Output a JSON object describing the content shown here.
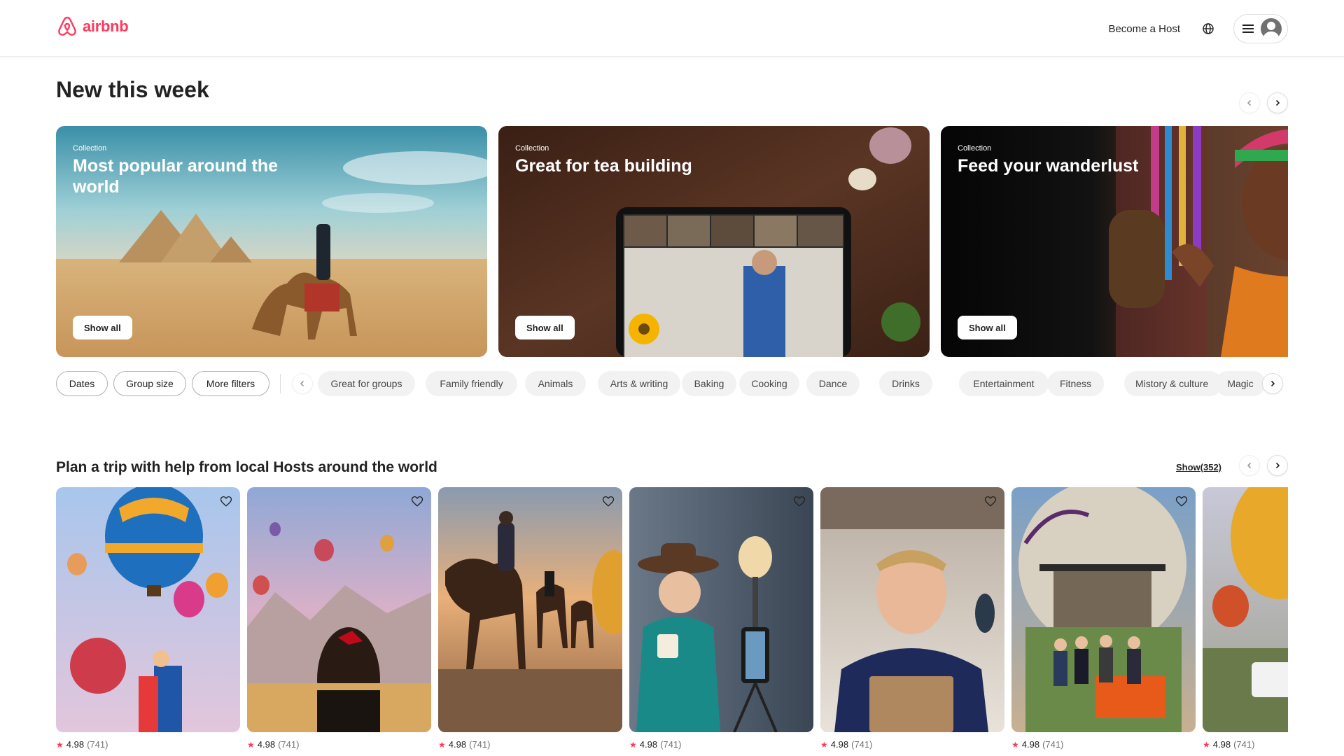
{
  "header": {
    "logo_text": "airbnb",
    "become_host": "Become a Host",
    "brand_color": "#ff385c"
  },
  "section1": {
    "title": "New this week",
    "collections": [
      {
        "label": "Collection",
        "title": "Most popular around the world",
        "button": "Show all"
      },
      {
        "label": "Collection",
        "title": "Great for tea building",
        "button": "Show all"
      },
      {
        "label": "Collection",
        "title": "Feed your wanderlust",
        "button": "Show all"
      }
    ]
  },
  "filters": {
    "outlined": [
      "Dates",
      "Group size",
      "More filters"
    ],
    "categories": [
      "Great for groups",
      "Family friendly",
      "Animals",
      "Arts & writing",
      "Baking",
      "Cooking",
      "Dance",
      "Drinks",
      "Entertainment",
      "Fitness",
      "Mistory & culture",
      "Magic"
    ]
  },
  "section2": {
    "title": "Plan a trip with help from local Hosts around the world",
    "show_count": "Show(352)",
    "cards": [
      {
        "rating": "4.98",
        "reviews": "(741)"
      },
      {
        "rating": "4.98",
        "reviews": "(741)"
      },
      {
        "rating": "4.98",
        "reviews": "(741)"
      },
      {
        "rating": "4.98",
        "reviews": "(741)"
      },
      {
        "rating": "4.98",
        "reviews": "(741)"
      },
      {
        "rating": "4.98",
        "reviews": "(741)"
      },
      {
        "rating": "4.98",
        "reviews": "(741)"
      }
    ]
  }
}
